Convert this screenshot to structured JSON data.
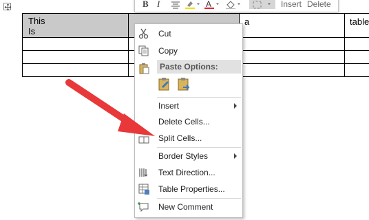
{
  "table": {
    "row1": [
      "This Is",
      "",
      "a",
      "table"
    ],
    "row1_line1": "This",
    "row1_line2": "Is"
  },
  "mini_toolbar": {
    "bold": "B",
    "italic": "I",
    "insert": "Insert",
    "delete": "Delete"
  },
  "context_menu": {
    "cut": "Cut",
    "copy": "Copy",
    "paste_options": "Paste Options:",
    "insert": "Insert",
    "delete_cells": "Delete Cells...",
    "split_cells": "Split Cells...",
    "border_styles": "Border Styles",
    "text_direction": "Text Direction...",
    "table_properties": "Table Properties...",
    "new_comment": "New Comment"
  },
  "colors": {
    "highlight": "#f5e000",
    "font_color": "#e1272e",
    "arrow": "#e8383a",
    "header_fill": "#c9c9c9"
  }
}
